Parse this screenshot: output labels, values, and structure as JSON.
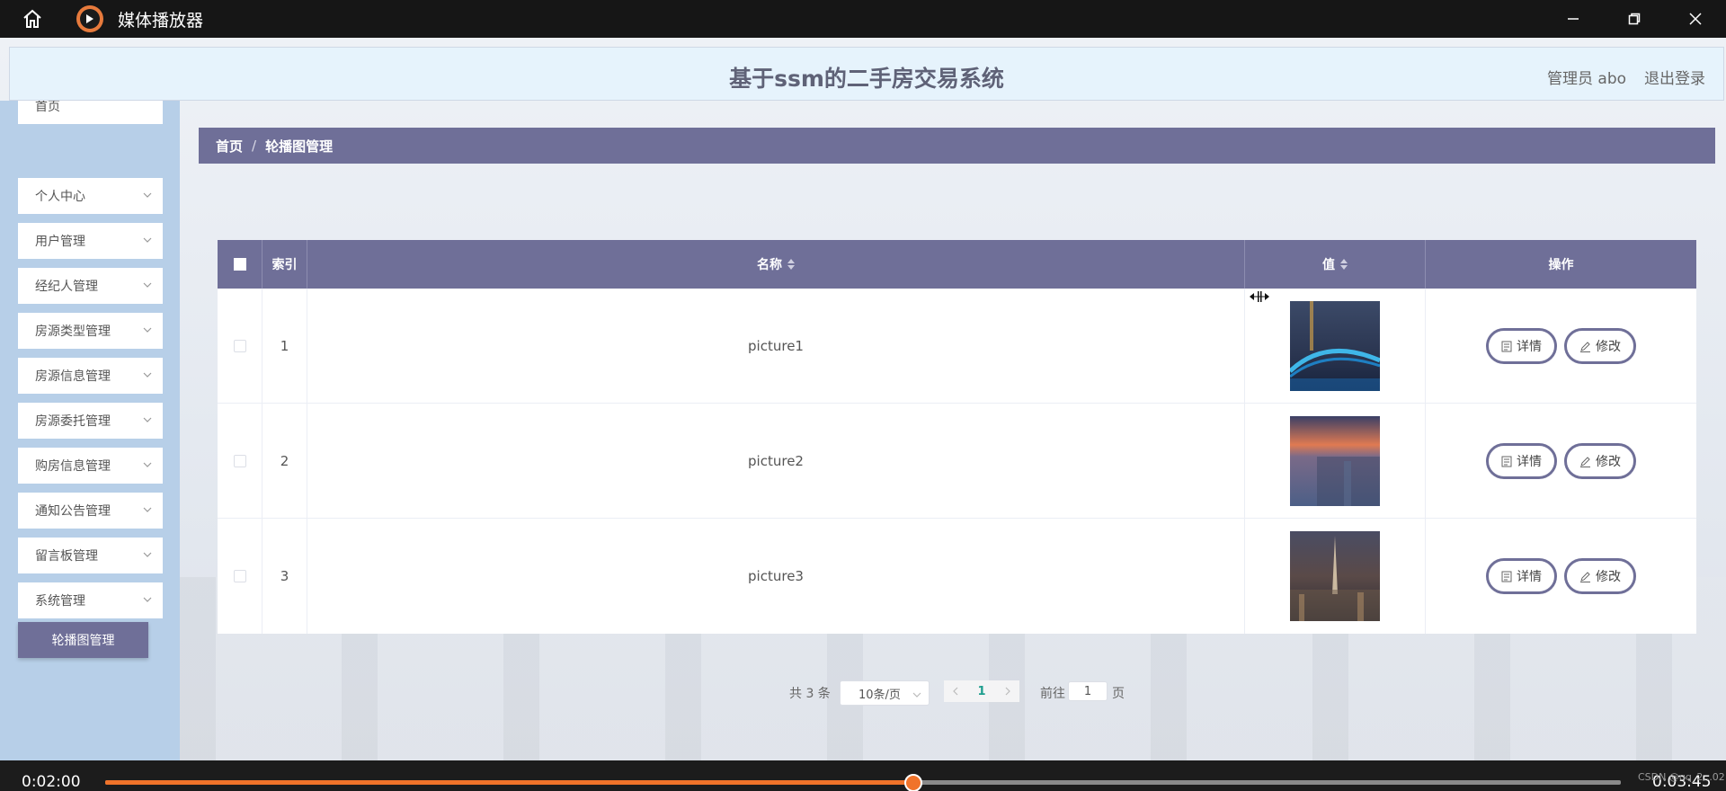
{
  "window": {
    "title": "媒体播放器"
  },
  "header": {
    "title": "基于ssm的二手房交易系统",
    "admin": "管理员 abo",
    "logout": "退出登录"
  },
  "sidebar": {
    "items": [
      {
        "label": "首页"
      },
      {
        "label": "个人中心"
      },
      {
        "label": "用户管理"
      },
      {
        "label": "经纪人管理"
      },
      {
        "label": "房源类型管理"
      },
      {
        "label": "房源信息管理"
      },
      {
        "label": "房源委托管理"
      },
      {
        "label": "购房信息管理"
      },
      {
        "label": "通知公告管理"
      },
      {
        "label": "留言板管理"
      },
      {
        "label": "系统管理"
      }
    ],
    "active_sub": "轮播图管理"
  },
  "breadcrumb": {
    "home": "首页",
    "separator": "/",
    "current": "轮播图管理"
  },
  "table": {
    "headers": {
      "index": "索引",
      "name": "名称",
      "value": "值",
      "actions": "操作"
    },
    "rows": [
      {
        "index": "1",
        "name": "picture1"
      },
      {
        "index": "2",
        "name": "picture2"
      },
      {
        "index": "3",
        "name": "picture3"
      }
    ],
    "detail_label": "详情",
    "edit_label": "修改"
  },
  "pagination": {
    "total": "共 3 条",
    "page_size": "10条/页",
    "current_page": "1",
    "goto_label": "前往",
    "goto_value": "1",
    "page_unit": "页"
  },
  "player": {
    "current_time": "0:02:00",
    "total_time": "0:03:45",
    "progress_percent": 53.3,
    "watermark": "CSDN @qq_2...02"
  },
  "colors": {
    "accent": "#6f6f98",
    "progress": "#f0732a",
    "sidebar_bg": "#b7cfe8",
    "header_bg": "#e6f3fc"
  }
}
